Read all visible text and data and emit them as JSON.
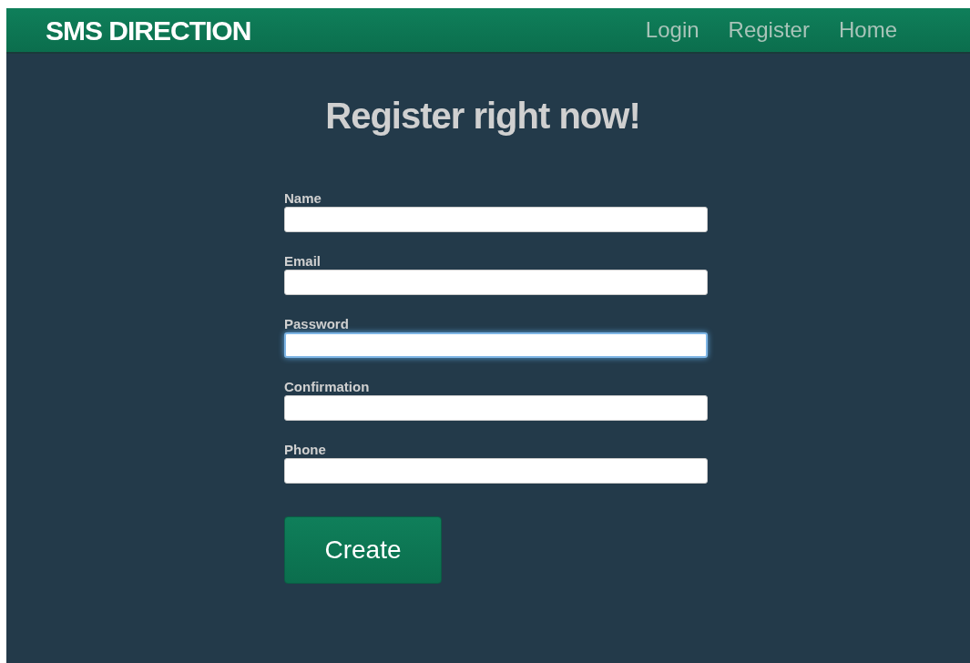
{
  "navbar": {
    "brand": "SMS DIRECTION",
    "links": [
      "Login",
      "Register",
      "Home"
    ]
  },
  "heading": "Register right now!",
  "fields": [
    {
      "label": "Name",
      "focused": false
    },
    {
      "label": "Email",
      "focused": false
    },
    {
      "label": "Password",
      "focused": true
    },
    {
      "label": "Confirmation",
      "focused": false
    },
    {
      "label": "Phone",
      "focused": false
    }
  ],
  "submit": "Create"
}
